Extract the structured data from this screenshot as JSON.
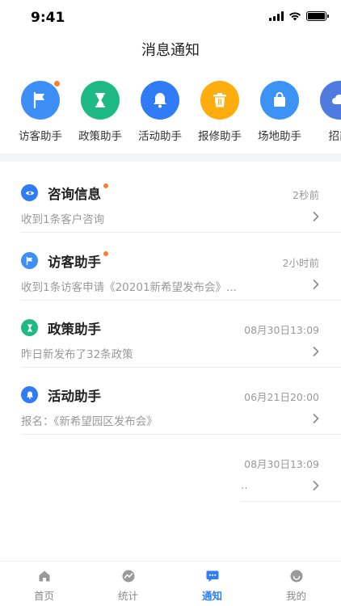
{
  "status_bar": {
    "time": "9:41"
  },
  "nav": {
    "title": "消息通知"
  },
  "helpers": [
    {
      "label": "访客助手",
      "color": "#3d8ff6",
      "icon": "flag-icon",
      "badge": true
    },
    {
      "label": "政策助手",
      "color": "#1fb985",
      "icon": "hourglass-icon",
      "badge": false
    },
    {
      "label": "活动助手",
      "color": "#2f7cf6",
      "icon": "bell-icon",
      "badge": false
    },
    {
      "label": "报修助手",
      "color": "#ffad0d",
      "icon": "trash-icon",
      "badge": false
    },
    {
      "label": "场地助手",
      "color": "#3d92f6",
      "icon": "bag-icon",
      "badge": false
    },
    {
      "label": "招商",
      "color": "#4f7ae0",
      "icon": "cloud-icon",
      "badge": false
    }
  ],
  "messages": [
    {
      "title": "咨询信息",
      "time": "2秒前",
      "subtitle": "收到1条客户咨询",
      "unread": true,
      "color": "#2f7cf6",
      "icon": "eye-icon"
    },
    {
      "title": "访客助手",
      "time": "2小时前",
      "subtitle": "收到1条访客申请《20201新希望发布会》...",
      "unread": true,
      "color": "#3d8ff6",
      "icon": "flag-icon"
    },
    {
      "title": "政策助手",
      "time": "08月30日13:09",
      "subtitle": "昨日新发布了32条政策",
      "unread": false,
      "color": "#1fb985",
      "icon": "hourglass-icon"
    },
    {
      "title": "活动助手",
      "time": "06月21日20:00",
      "subtitle": "报名：《新希望园区发布会》",
      "unread": false,
      "color": "#2f7cf6",
      "icon": "bell-icon"
    },
    {
      "title": "",
      "time": "08月30日13:09",
      "subtitle": "..",
      "unread": false,
      "color": "",
      "icon": ""
    }
  ],
  "tabs": [
    {
      "label": "首页",
      "icon": "home-icon",
      "active": false
    },
    {
      "label": "统计",
      "icon": "stats-icon",
      "active": false
    },
    {
      "label": "通知",
      "icon": "message-icon",
      "active": true
    },
    {
      "label": "我的",
      "icon": "profile-icon",
      "active": false
    }
  ]
}
